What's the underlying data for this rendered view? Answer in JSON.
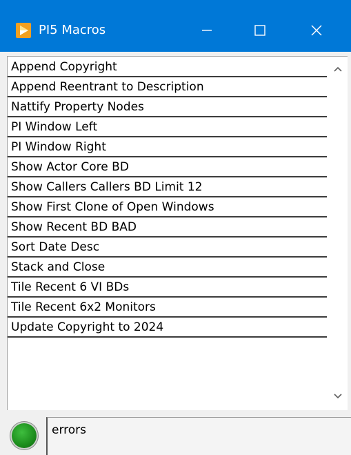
{
  "window": {
    "title": "PI5 Macros",
    "title_bar_color": "#0078d7",
    "icon": "labview-run-arrow-icon",
    "controls": [
      "minimize-icon",
      "maximize-icon",
      "close-icon"
    ]
  },
  "macro_list": {
    "items": [
      "Append Copyright",
      "Append Reentrant to Description",
      "Nattify Property Nodes",
      "PI Window Left",
      "PI Window Right",
      "Show Actor Core BD",
      "Show Callers Callers BD Limit 12",
      "Show First Clone of Open Windows",
      "Show Recent BD BAD",
      "Sort Date Desc",
      "Stack and Close",
      "Tile Recent 6 VI BDs",
      "Tile Recent 6x2 Monitors",
      "Update Copyright to 2024"
    ]
  },
  "status": {
    "led_color": "#1c8d1c",
    "label": "errors"
  }
}
